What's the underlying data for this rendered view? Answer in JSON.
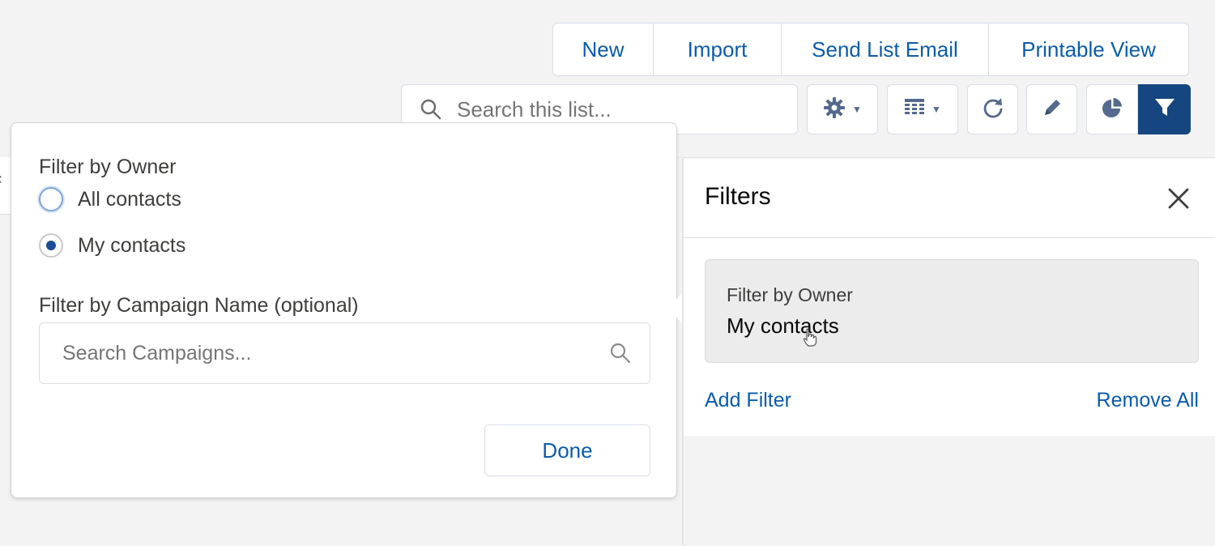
{
  "toolbar": {
    "buttons": [
      "New",
      "Import",
      "Send List Email",
      "Printable View"
    ],
    "search_placeholder": "Search this list..."
  },
  "tools": {
    "settings_icon": "gear-icon",
    "display_icon": "table-icon",
    "refresh_icon": "refresh-icon",
    "edit_icon": "pencil-icon",
    "chart_icon": "pie-chart-icon",
    "filter_icon": "filter-icon"
  },
  "popover": {
    "owner_label": "Filter by Owner",
    "options": [
      {
        "label": "All contacts",
        "checked": false
      },
      {
        "label": "My contacts",
        "checked": true
      }
    ],
    "campaign_label": "Filter by Campaign Name (optional)",
    "campaign_placeholder": "Search Campaigns...",
    "done_label": "Done"
  },
  "filters": {
    "title": "Filters",
    "card_label": "Filter by Owner",
    "card_value": "My contacts",
    "add_filter": "Add Filter",
    "remove_all": "Remove All"
  },
  "colors": {
    "accent": "#0b5cab",
    "active_button": "#16467f",
    "text": "#3e3e3c"
  }
}
